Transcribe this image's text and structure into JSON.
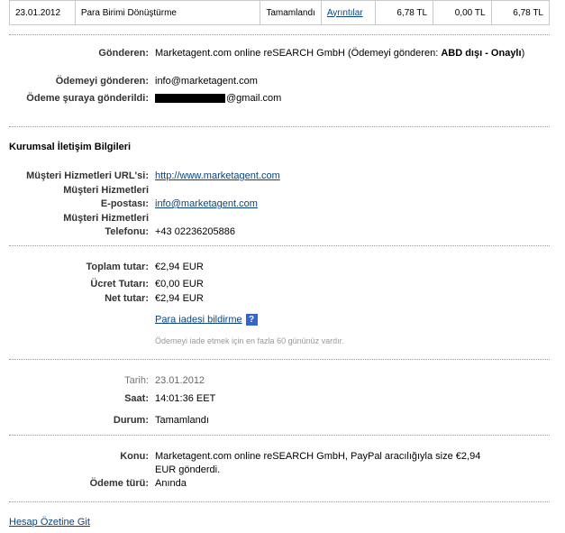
{
  "transaction_row": {
    "date": "23.01.2012",
    "type": "Para Birimi Dönüştürme",
    "status": "Tamamlandı",
    "details_link": "Ayrıntılar",
    "gross": "6,78 TL",
    "fee": "0,00 TL",
    "net": "6,78 TL"
  },
  "sender": {
    "from_label": "Gönderen:",
    "from_value_prefix": "Marketagent.com online reSEARCH GmbH (Ödemeyi gönderen: ",
    "from_value_bold": "ABD dışı - Onaylı",
    "from_value_suffix": ")",
    "payer_label": "Ödemeyi gönderen:",
    "payer_value": "info@marketagent.com",
    "sent_to_label": "Ödeme şuraya gönderildi:",
    "sent_to_value": "@gmail.com"
  },
  "contact": {
    "title": "Kurumsal İletişim Bilgileri",
    "url_label": "Müşteri Hizmetleri URL'si:",
    "url_value": "http://www.marketagent.com",
    "email_label_line1": "Müşteri Hizmetleri",
    "email_label_line2": "E-postası:",
    "email_value": "info@marketagent.com",
    "phone_label_line1": "Müşteri Hizmetleri",
    "phone_label_line2": "Telefonu:",
    "phone_value": "+43 02236205886"
  },
  "amounts": {
    "total_label": "Toplam tutar:",
    "total_value": "€2,94 EUR",
    "fee_label": "Ücret Tutarı:",
    "fee_value": "€0,00 EUR",
    "net_label": "Net tutar:",
    "net_value": "€2,94 EUR",
    "refund_link": "Para iadesi bildirme",
    "help_icon": "?",
    "refund_note": "Ödemeyi iade etmek için en fazla 60 gününüz vardır."
  },
  "datetime": {
    "date_label": "Tarih:",
    "date_value": "23.01.2012",
    "time_label": "Saat:",
    "time_value": "14:01:36 EET",
    "status_label": "Durum:",
    "status_value": "Tamamlandı"
  },
  "subject": {
    "subject_label": "Konu:",
    "subject_line1": "Marketagent.com online reSEARCH GmbH, PayPal aracılığıyla size €2,94",
    "subject_line2": "EUR gönderdi.",
    "payment_type_label": "Ödeme türü:",
    "payment_type_value": "Anında"
  },
  "footer": {
    "back_link": "Hesap Özetine Git"
  }
}
